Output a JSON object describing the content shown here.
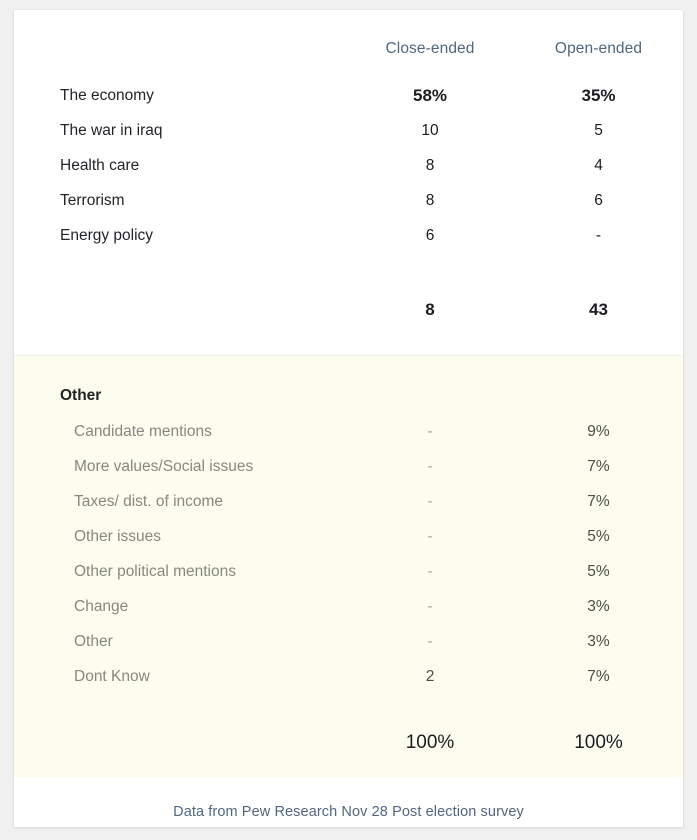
{
  "table": {
    "columns": [
      {
        "id": "close_ended",
        "label": "Close-ended"
      },
      {
        "id": "open_ended",
        "label": "Open-ended"
      }
    ],
    "header_color": "#50687f",
    "main_rows": [
      {
        "label": "The economy",
        "close_ended": "58%",
        "open_ended": "35%",
        "emphasis": true
      },
      {
        "label": "The war in iraq",
        "close_ended": "10",
        "open_ended": "5",
        "emphasis": false
      },
      {
        "label": "Health care",
        "close_ended": "8",
        "open_ended": "4",
        "emphasis": false
      },
      {
        "label": "Terrorism",
        "close_ended": "8",
        "open_ended": "6",
        "emphasis": false
      },
      {
        "label": "Energy policy",
        "close_ended": "6",
        "open_ended": "-",
        "emphasis": false
      }
    ],
    "subtotal": {
      "label": "",
      "close_ended": "8",
      "open_ended": "43"
    },
    "other_section": {
      "heading": "Other",
      "background_color": "#fdfdef",
      "rows": [
        {
          "label": "Candidate mentions",
          "close_ended": "-",
          "open_ended": "9%"
        },
        {
          "label": "More values/Social issues",
          "close_ended": "-",
          "open_ended": "7%"
        },
        {
          "label": "Taxes/ dist. of income",
          "close_ended": "-",
          "open_ended": "7%"
        },
        {
          "label": "Other issues",
          "close_ended": "-",
          "open_ended": "5%"
        },
        {
          "label": "Other political mentions",
          "close_ended": "-",
          "open_ended": "5%"
        },
        {
          "label": "Change",
          "close_ended": "-",
          "open_ended": "3%"
        },
        {
          "label": "Other",
          "close_ended": "-",
          "open_ended": "3%"
        },
        {
          "label": "Dont Know",
          "close_ended": "2",
          "open_ended": "7%"
        }
      ],
      "total": {
        "close_ended": "100%",
        "open_ended": "100%"
      }
    }
  },
  "footer": {
    "source_text": "Data from Pew Research Nov 28 Post election survey",
    "color": "#51677f"
  },
  "chart_data": {
    "type": "table",
    "title": "",
    "categories": [
      "The economy",
      "The war in iraq",
      "Health care",
      "Terrorism",
      "Energy policy",
      "Subtotal",
      "Candidate mentions",
      "More values/Social issues",
      "Taxes/ dist. of income",
      "Other issues",
      "Other political mentions",
      "Change",
      "Other",
      "Dont Know",
      "Total"
    ],
    "series": [
      {
        "name": "Close-ended",
        "values": [
          58,
          10,
          8,
          8,
          6,
          8,
          null,
          null,
          null,
          null,
          null,
          null,
          null,
          2,
          100
        ]
      },
      {
        "name": "Open-ended",
        "values": [
          35,
          5,
          4,
          6,
          null,
          43,
          9,
          7,
          7,
          5,
          5,
          3,
          3,
          7,
          100
        ]
      }
    ],
    "units": "percent",
    "legend": [
      "Close-ended",
      "Open-ended"
    ],
    "annotations": [
      "Data from Pew Research Nov 28 Post election survey"
    ]
  }
}
